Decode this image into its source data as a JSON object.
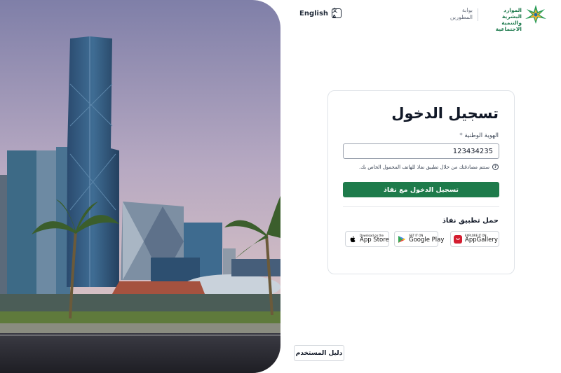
{
  "header": {
    "language_label": "English",
    "language_icon": "translate-icon",
    "portal_label": "بوابة المطورين",
    "ministry_name": "الموارد البشرية والتنمية الاجتماعية",
    "ministry_logo_icon": "ministry-star-logo"
  },
  "login": {
    "title": "تسجيل الدخول",
    "id_label": "الهوية الوطنية",
    "id_required_mark": "*",
    "id_value": "123434235",
    "hint_icon": "question-circle-icon",
    "hint_text": "ستتم مصادقتك من خلال تطبيق نفاذ للهاتف المحمول الخاص بك.",
    "submit_label": "تسجيل الدخول مع نفاذ",
    "download_title": "حمل تطبيق نفاذ",
    "stores": [
      {
        "small": "Download on the",
        "name": "App Store",
        "icon": "apple-icon"
      },
      {
        "small": "GET IT ON",
        "name": "Google Play",
        "icon": "google-play-icon"
      },
      {
        "small": "EXPLORE IT ON",
        "name": "AppGallery",
        "icon": "huawei-appgallery-icon"
      }
    ]
  },
  "footer": {
    "user_guide_label": "دليل المستخدم"
  },
  "colors": {
    "primary_green": "#1e7b4b",
    "border": "#dfe3e8",
    "text": "#111827"
  }
}
